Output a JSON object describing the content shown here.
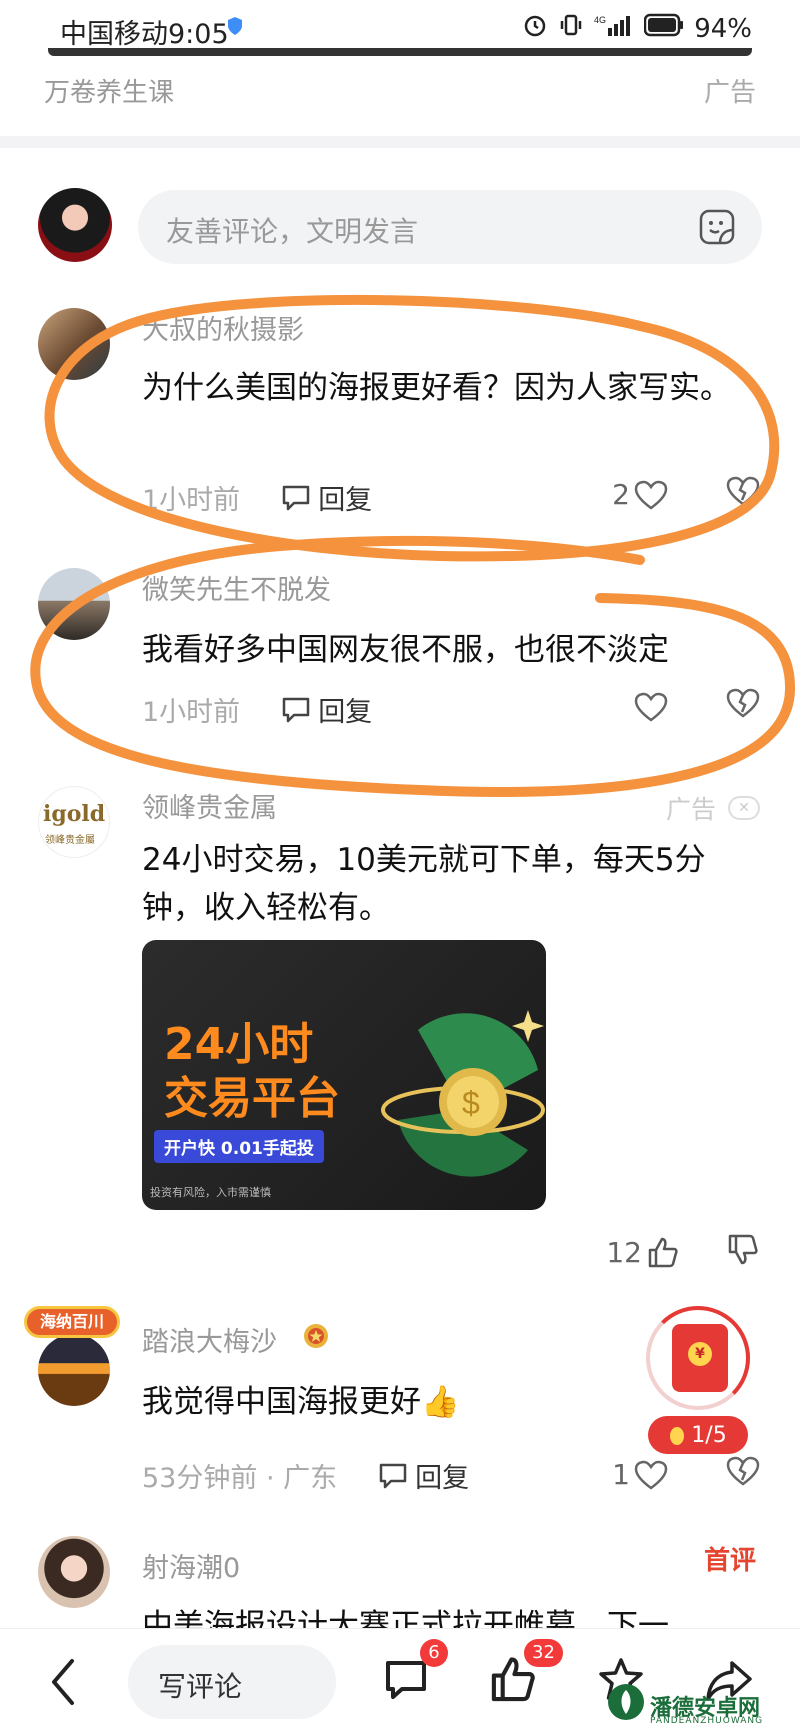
{
  "status_bar": {
    "carrier_time": "中国移动9:05",
    "network": "4G",
    "battery": "94%"
  },
  "ad_top": {
    "name": "万卷养生课",
    "ad_label": "广告"
  },
  "comment_input": {
    "placeholder": "友善评论，文明发言"
  },
  "comments": [
    {
      "user": "大叔的秋摄影",
      "text": "为什么美国的海报更好看？因为人家写实。",
      "time": "1小时前",
      "reply_label": "回复",
      "likes": "2"
    },
    {
      "user": "微笑先生不脱发",
      "text": "我看好多中国网友很不服，也很不淡定",
      "time": "1小时前",
      "reply_label": "回复",
      "likes": ""
    },
    {
      "user": "踏浪大梅沙",
      "text": "我觉得中国海报更好👍",
      "time": "53分钟前 · 广东",
      "reply_label": "回复",
      "likes": "1",
      "badge": "海纳百川"
    },
    {
      "user": "射海潮0",
      "text": "中美海报设计大赛正式拉开帷幕，下一",
      "first_tag": "首评"
    }
  ],
  "ad_comment": {
    "brand": "领峰贵金属",
    "logo_text": "igold",
    "logo_sub": "领峰贵金屬",
    "ad_label": "广告",
    "text": "24小时交易，10美元就可下单，每天5分钟，收入轻松有。",
    "image_title_line1": "24小时",
    "image_title_line2": "交易平台",
    "image_badge": "开户快 0.01手起投",
    "image_risk": "投资有风险，入市需谨慎",
    "likes": "12"
  },
  "red_packet": {
    "progress": "1/5",
    "symbol": "¥"
  },
  "bottom_bar": {
    "write_label": "写评论",
    "comment_count": "6",
    "like_count": "32"
  },
  "watermark": {
    "text": "潘德安卓网",
    "sub": "PANDEANZHUOWANG"
  },
  "colors": {
    "accent_red": "#e53935",
    "annotation_orange": "#f5923e",
    "text_gray": "#999999"
  }
}
